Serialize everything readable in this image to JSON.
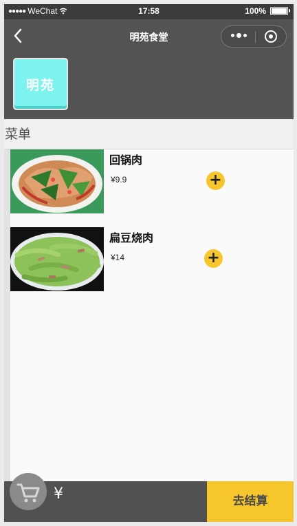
{
  "status_bar": {
    "signal": "●●●●●",
    "carrier": "WeChat",
    "wifi_icon": "wifi-icon",
    "time": "17:58",
    "battery_text": "100%"
  },
  "navbar": {
    "title": "明苑食堂",
    "back_icon": "chevron-left-icon",
    "more_icon": "more-dots-icon",
    "close_icon": "target-circle-icon"
  },
  "shop": {
    "logo_text": "明苑"
  },
  "menu": {
    "heading": "菜单",
    "items": [
      {
        "name": "回锅肉",
        "price": "¥9.9",
        "add_label": "+"
      },
      {
        "name": "扁豆烧肉",
        "price": "¥14",
        "add_label": "+"
      }
    ]
  },
  "cart": {
    "icon": "cart-icon",
    "total": "¥",
    "checkout_label": "去结算"
  },
  "colors": {
    "bar": "#535353",
    "accent": "#f7c52c",
    "logo_bg": "#7df3ef"
  }
}
